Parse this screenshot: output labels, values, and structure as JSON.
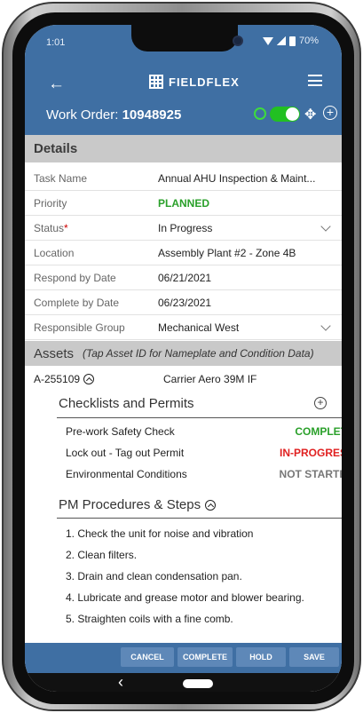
{
  "status_bar": {
    "time": "1:01",
    "battery": "70%"
  },
  "app": {
    "brand": "FIELDFLEX"
  },
  "work_order": {
    "label": "Work Order:",
    "number": "10948925"
  },
  "details": {
    "header": "Details",
    "fields": [
      {
        "label": "Task Name",
        "value": "Annual AHU Inspection & Maint..."
      },
      {
        "label": "Priority",
        "value": "PLANNED"
      },
      {
        "label": "Status",
        "value": "In Progress",
        "required": "*"
      },
      {
        "label": "Location",
        "value": "Assembly Plant #2 - Zone 4B"
      },
      {
        "label": "Respond by Date",
        "value": "06/21/2021"
      },
      {
        "label": "Complete by Date",
        "value": "06/23/2021"
      },
      {
        "label": "Responsible Group",
        "value": "Mechanical West"
      }
    ]
  },
  "assets": {
    "header": "Assets",
    "note": "(Tap Asset ID for Nameplate and Condition Data)",
    "items": [
      {
        "id": "A-255109",
        "model": "Carrier Aero 39M IF"
      }
    ]
  },
  "checklists": {
    "header": "Checklists and Permits",
    "items": [
      {
        "name": "Pre-work Safety Check",
        "status": "COMPLETE",
        "color": "#2aa02a"
      },
      {
        "name": "Lock out - Tag out Permit",
        "status": "IN-PROGRESS",
        "color": "#e02020"
      },
      {
        "name": "Environmental Conditions",
        "status": "NOT STARTED",
        "color": "#777777"
      }
    ]
  },
  "procedures": {
    "header": "PM Procedures & Steps",
    "steps": [
      {
        "text": "1. Check the unit for noise and vibration",
        "checked": true
      },
      {
        "text": "2. Clean filters.",
        "checked": true
      },
      {
        "text": "3. Drain and clean condensation pan.",
        "checked": true
      },
      {
        "text": "4. Lubricate and grease motor and blower bearing.",
        "checked": false
      },
      {
        "text": "5. Straighten coils with a fine comb.",
        "checked": false
      }
    ]
  },
  "actions": {
    "cancel": "CANCEL",
    "complete": "COMPLETE",
    "hold": "HOLD",
    "save": "SAVE"
  },
  "colors": {
    "brand_blue": "#3f6fa3",
    "toggle_green": "#22c022",
    "check_green": "#2ba72b"
  }
}
